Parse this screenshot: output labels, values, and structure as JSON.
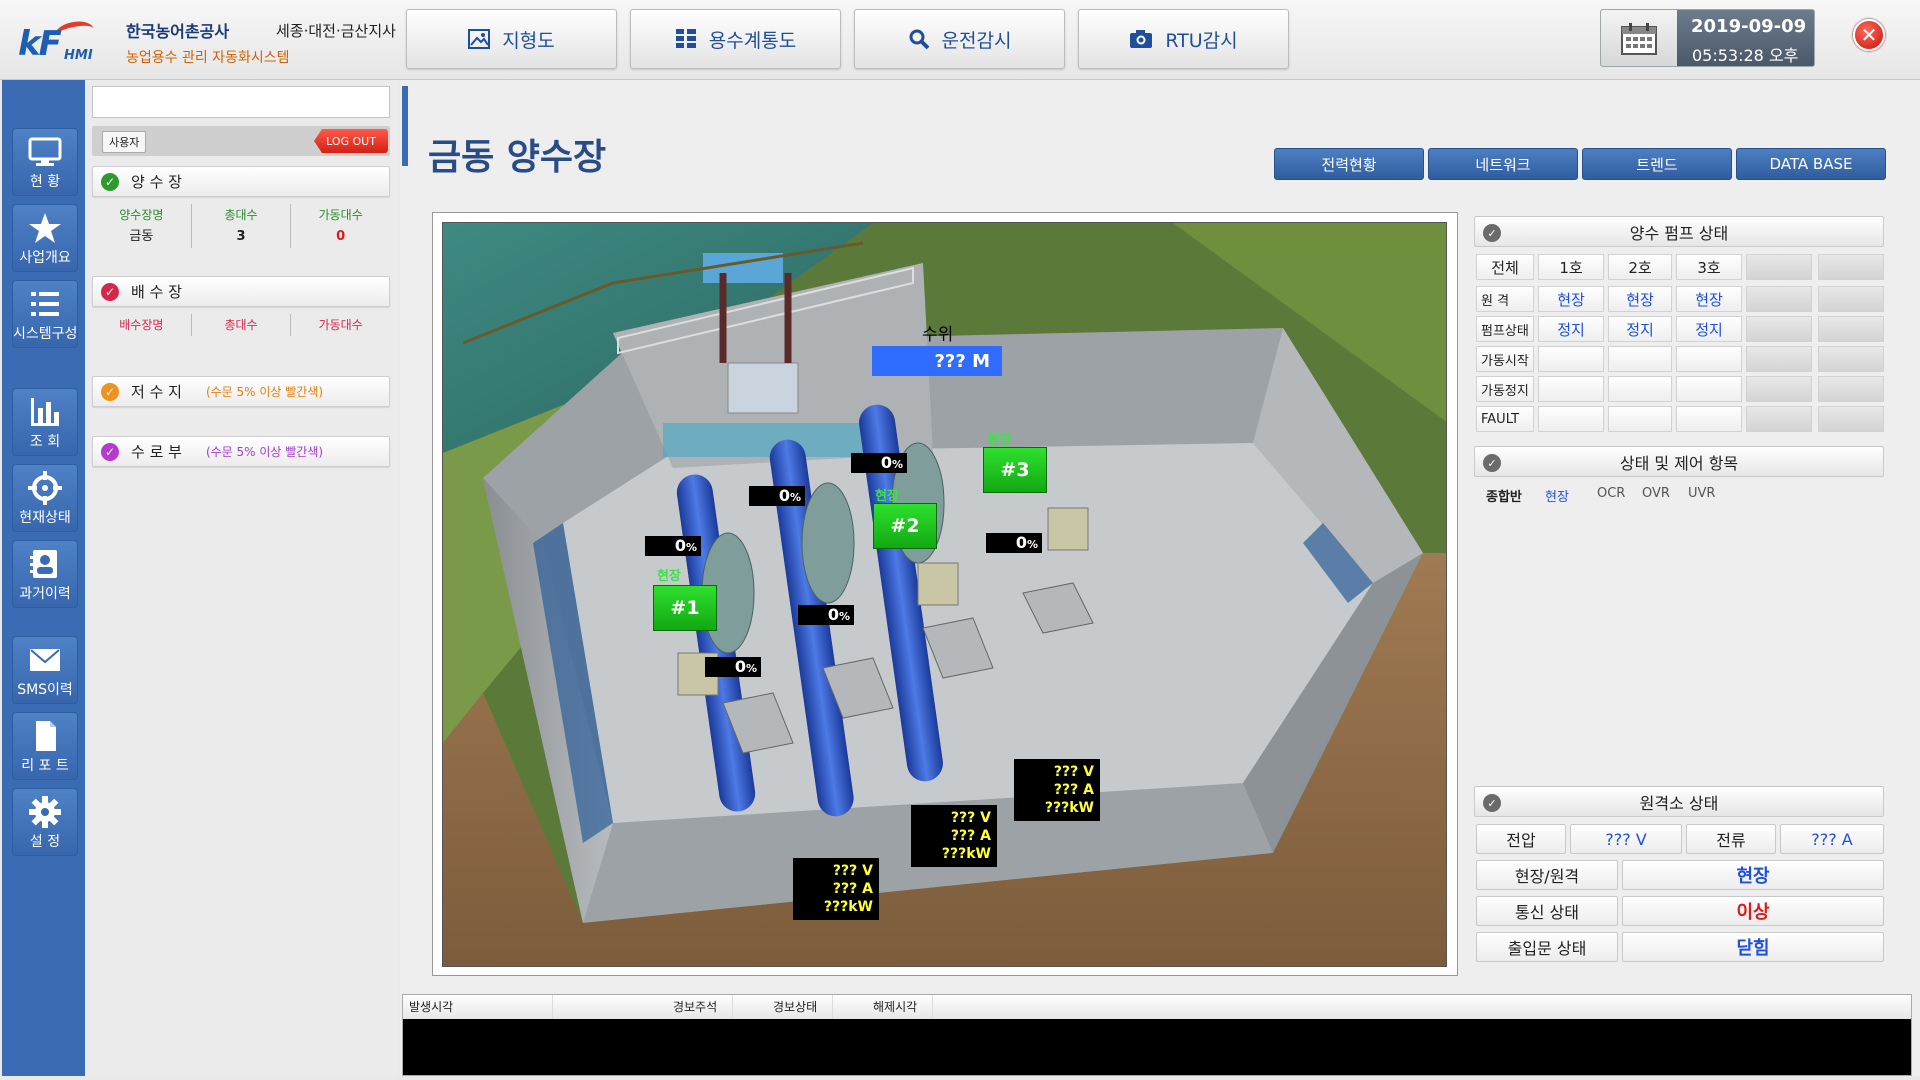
{
  "header": {
    "org": "한국농어촌공사",
    "branch": "세종·대전·금산지사",
    "system": "농업용수 관리 자동화시스템",
    "logo_text": "KF HMI",
    "nav": [
      "지형도",
      "용수계통도",
      "운전감시",
      "RTU감시"
    ],
    "date": "2019-09-09",
    "time": "05:53:28 오후"
  },
  "sidebar": {
    "items": [
      {
        "label": "현   황",
        "icon": "monitor-icon"
      },
      {
        "label": "사업개요",
        "icon": "star-icon"
      },
      {
        "label": "시스템구성",
        "icon": "list-icon"
      },
      {
        "label": "조   회",
        "icon": "bar-chart-icon"
      },
      {
        "label": "현재상태",
        "icon": "crosshair-icon"
      },
      {
        "label": "과거이력",
        "icon": "person-card-icon"
      },
      {
        "label": "SMS이력",
        "icon": "envelope-icon"
      },
      {
        "label": "리 포 트",
        "icon": "document-icon"
      },
      {
        "label": "설   정",
        "icon": "gear-icon"
      }
    ]
  },
  "status": {
    "user_label": "사용자",
    "logout": "LOG OUT",
    "pump_station": {
      "title": "양 수 장",
      "cols": [
        "양수장명",
        "총대수",
        "가동대수"
      ],
      "row": [
        "금동",
        "3",
        "0"
      ]
    },
    "drain_station": {
      "title": "배 수 장",
      "cols": [
        "배수장명",
        "총대수",
        "가동대수"
      ]
    },
    "reservoir": {
      "title": "저 수 지",
      "note": "(수문 5% 이상 빨간색)"
    },
    "waterway": {
      "title": "수 로 부",
      "note": "(수문 5% 이상 빨간색)"
    }
  },
  "page": {
    "title": "금동 양수장",
    "tabs": [
      "전력현황",
      "네트워크",
      "트렌드",
      "DATA BASE"
    ]
  },
  "scene": {
    "level_label": "수위",
    "level_value": "???  M",
    "gates": [
      "0",
      "0",
      "0",
      "0",
      "0",
      "0"
    ],
    "pct_unit": "%",
    "pumps": [
      {
        "id": "#1",
        "mode": "현장"
      },
      {
        "id": "#2",
        "mode": "현장"
      },
      {
        "id": "#3",
        "mode": "현장"
      }
    ],
    "electric": [
      {
        "v": "??? V",
        "a": "??? A",
        "kw": "???kW"
      },
      {
        "v": "??? V",
        "a": "??? A",
        "kw": "???kW"
      },
      {
        "v": "??? V",
        "a": "??? A",
        "kw": "???kW"
      }
    ]
  },
  "pump_status": {
    "title": "양수 펌프 상태",
    "header": [
      "전체",
      "1호",
      "2호",
      "3호"
    ],
    "rows": [
      {
        "label": "원 격",
        "values": [
          "현장",
          "현장",
          "현장"
        ]
      },
      {
        "label": "펌프상태",
        "values": [
          "정지",
          "정지",
          "정지"
        ]
      },
      {
        "label": "가동시작",
        "values": [
          "",
          "",
          ""
        ]
      },
      {
        "label": "가동정지",
        "values": [
          "",
          "",
          ""
        ]
      },
      {
        "label": "FAULT",
        "values": [
          "",
          "",
          ""
        ]
      }
    ]
  },
  "control": {
    "title": "상태 및 제어 항목",
    "items": [
      "종합반",
      "현장",
      "OCR",
      "OVR",
      "UVR"
    ]
  },
  "remote": {
    "title": "원격소 상태",
    "voltage_label": "전압",
    "voltage_value": "??? V",
    "current_label": "전류",
    "current_value": "??? A",
    "rows": [
      {
        "label": "현장/원격",
        "value": "현장",
        "color": "#1d4fe0"
      },
      {
        "label": "통신 상태",
        "value": "이상",
        "color": "#e01818"
      },
      {
        "label": "출입문 상태",
        "value": "닫힘",
        "color": "#1d4fe0"
      }
    ]
  },
  "alarm": {
    "columns": [
      "발생시각",
      "경보주석",
      "경보상태",
      "해제시각"
    ]
  },
  "colors": {
    "accent": "#3b6cb3",
    "pump_green": "#19c419",
    "red": "#e01818",
    "blue_value": "#1d4fe0"
  }
}
